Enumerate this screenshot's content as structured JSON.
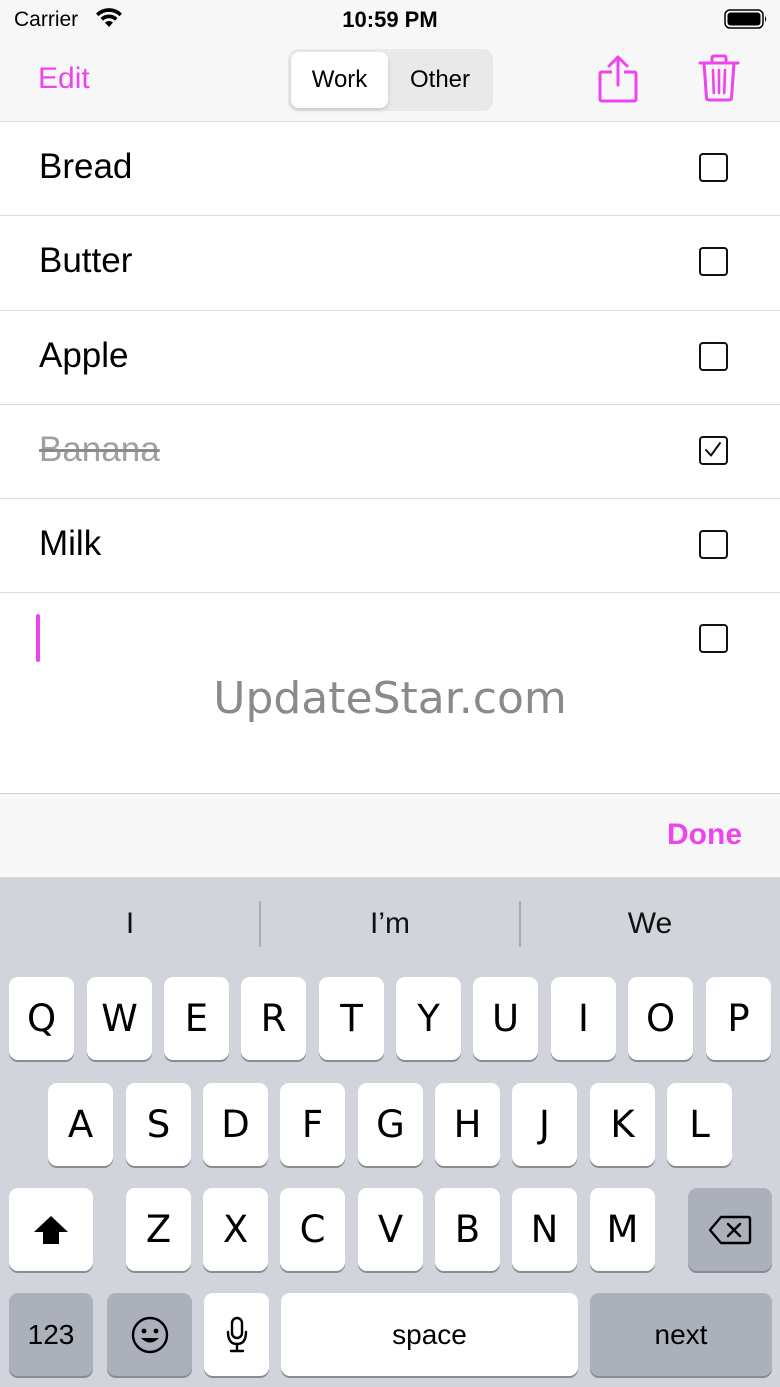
{
  "status_bar": {
    "carrier": "Carrier",
    "time": "10:59 PM"
  },
  "nav": {
    "edit_label": "Edit",
    "segments": [
      "Work",
      "Other"
    ],
    "selected_segment": "Work",
    "icons": [
      "share-icon",
      "trash-icon"
    ]
  },
  "list": {
    "items": [
      {
        "label": "Bread",
        "checked": false
      },
      {
        "label": "Butter",
        "checked": false
      },
      {
        "label": "Apple",
        "checked": false
      },
      {
        "label": "Banana",
        "checked": true
      },
      {
        "label": "Milk",
        "checked": false
      },
      {
        "label": "",
        "checked": false
      }
    ]
  },
  "watermark": "UpdateStar.com",
  "accessory": {
    "done_label": "Done"
  },
  "keyboard": {
    "suggestions": [
      "I",
      "I’m",
      "We"
    ],
    "row1": [
      "Q",
      "W",
      "E",
      "R",
      "T",
      "Y",
      "U",
      "I",
      "O",
      "P"
    ],
    "row2": [
      "A",
      "S",
      "D",
      "F",
      "G",
      "H",
      "J",
      "K",
      "L"
    ],
    "row3": [
      "Z",
      "X",
      "C",
      "V",
      "B",
      "N",
      "M"
    ],
    "numbers_label": "123",
    "space_label": "space",
    "next_label": "next"
  },
  "colors": {
    "accent": "#ee44ee"
  }
}
